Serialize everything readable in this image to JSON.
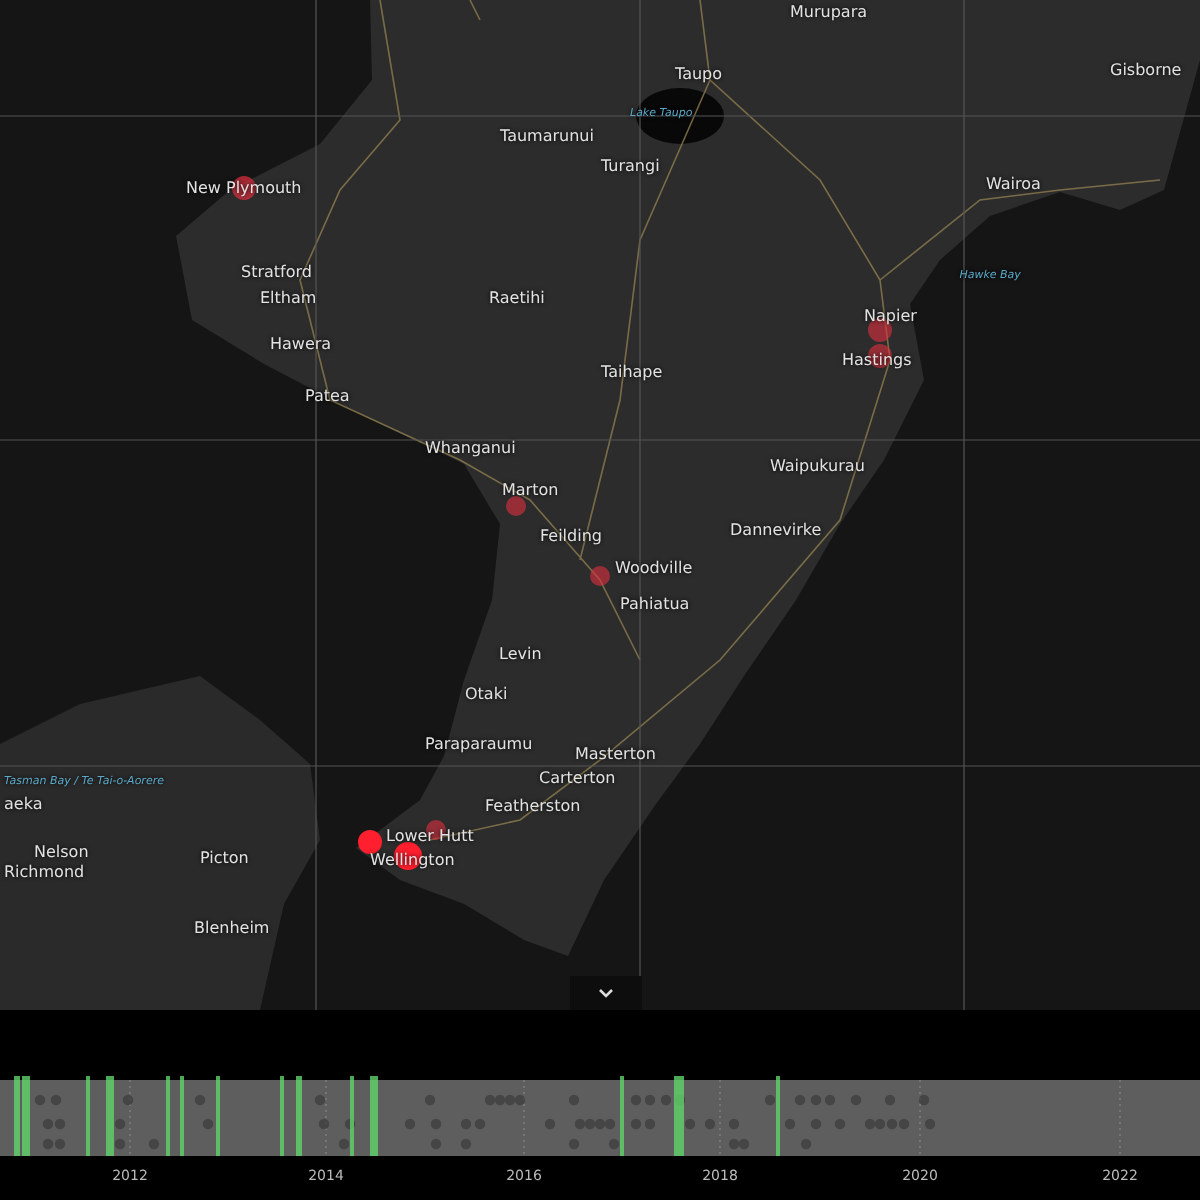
{
  "map": {
    "labels": [
      {
        "text": "Murupara",
        "kind": "town"
      },
      {
        "text": "Taupo",
        "kind": "town"
      },
      {
        "text": "Lake Taupo",
        "kind": "water"
      },
      {
        "text": "Gisborne",
        "kind": "town"
      },
      {
        "text": "Taumarunui",
        "kind": "town"
      },
      {
        "text": "Turangi",
        "kind": "town"
      },
      {
        "text": "New Plymouth",
        "kind": "town"
      },
      {
        "text": "Wairoa",
        "kind": "town"
      },
      {
        "text": "Stratford",
        "kind": "town"
      },
      {
        "text": "Hawke Bay",
        "kind": "water"
      },
      {
        "text": "Eltham",
        "kind": "town"
      },
      {
        "text": "Raetihi",
        "kind": "town"
      },
      {
        "text": "Napier",
        "kind": "town"
      },
      {
        "text": "Hawera",
        "kind": "town"
      },
      {
        "text": "Hastings",
        "kind": "town"
      },
      {
        "text": "Taihape",
        "kind": "town"
      },
      {
        "text": "Patea",
        "kind": "town"
      },
      {
        "text": "Whanganui",
        "kind": "town"
      },
      {
        "text": "Waipukurau",
        "kind": "town"
      },
      {
        "text": "Marton",
        "kind": "town"
      },
      {
        "text": "Feilding",
        "kind": "town"
      },
      {
        "text": "Dannevirke",
        "kind": "town"
      },
      {
        "text": "Woodville",
        "kind": "town"
      },
      {
        "text": "Pahiatua",
        "kind": "town"
      },
      {
        "text": "Levin",
        "kind": "town"
      },
      {
        "text": "Otaki",
        "kind": "town"
      },
      {
        "text": "Paraparaumu",
        "kind": "town"
      },
      {
        "text": "Masterton",
        "kind": "town"
      },
      {
        "text": "Tasman Bay / Te Tai-o-Aorere",
        "kind": "water"
      },
      {
        "text": "Carterton",
        "kind": "town"
      },
      {
        "text": "aeka",
        "kind": "town"
      },
      {
        "text": "Featherston",
        "kind": "town"
      },
      {
        "text": "Lower Hutt",
        "kind": "town"
      },
      {
        "text": "Nelson",
        "kind": "town"
      },
      {
        "text": "Picton",
        "kind": "town"
      },
      {
        "text": "Wellington",
        "kind": "town"
      },
      {
        "text": "Richmond",
        "kind": "town"
      },
      {
        "text": "Blenheim",
        "kind": "town"
      }
    ]
  },
  "timeline": {
    "years": [
      "2012",
      "2014",
      "2016",
      "2018",
      "2020",
      "2022"
    ]
  }
}
